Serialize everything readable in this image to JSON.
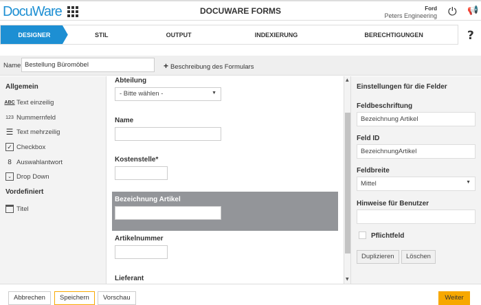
{
  "header": {
    "logo": "DocuWare",
    "title": "DOCUWARE FORMS",
    "user_name": "Ford",
    "organization": "Peters Engineering"
  },
  "steps": [
    "DESIGNER",
    "STIL",
    "OUTPUT",
    "INDEXIERUNG",
    "BERECHTIGUNGEN"
  ],
  "help": "?",
  "namebar": {
    "label": "Name",
    "value": "Bestellung Büromöbel",
    "description_link": "Beschreibung des Formulars"
  },
  "palette": {
    "general_heading": "Allgemein",
    "items": [
      "Text einzeilig",
      "Nummernfeld",
      "Text mehrzeilig",
      "Checkbox",
      "Auswahlantwort",
      "Drop Down"
    ],
    "icons": {
      "abc": "ABC",
      "num": "123"
    },
    "predefined_heading": "Vordefiniert",
    "predefined_items": [
      "Titel"
    ]
  },
  "form": {
    "fields": [
      {
        "label": "Abteilung",
        "value": "- Bitte wählen -"
      },
      {
        "label": "Name"
      },
      {
        "label": "Kostenstelle*"
      },
      {
        "label": "Bezeichnung Artikel"
      },
      {
        "label": "Artikelnummer"
      },
      {
        "label": "Lieferant"
      }
    ]
  },
  "settings": {
    "title": "Einstellungen für die Felder",
    "caption_label": "Feldbeschriftung",
    "caption_value": "Bezeichnung Artikel",
    "id_label": "Feld ID",
    "id_value": "BezeichnungArtikel",
    "width_label": "Feldbreite",
    "width_value": "Mittel",
    "hints_label": "Hinweise für Benutzer",
    "hints_value": "",
    "required_label": "Pflichtfeld",
    "duplicate": "Duplizieren",
    "delete": "Löschen"
  },
  "footer": {
    "cancel": "Abbrechen",
    "save": "Speichern",
    "preview": "Vorschau",
    "next": "Weiter"
  },
  "colors": {
    "accent": "#1d8fd3",
    "next": "#f7a800",
    "selected": "#939599"
  }
}
